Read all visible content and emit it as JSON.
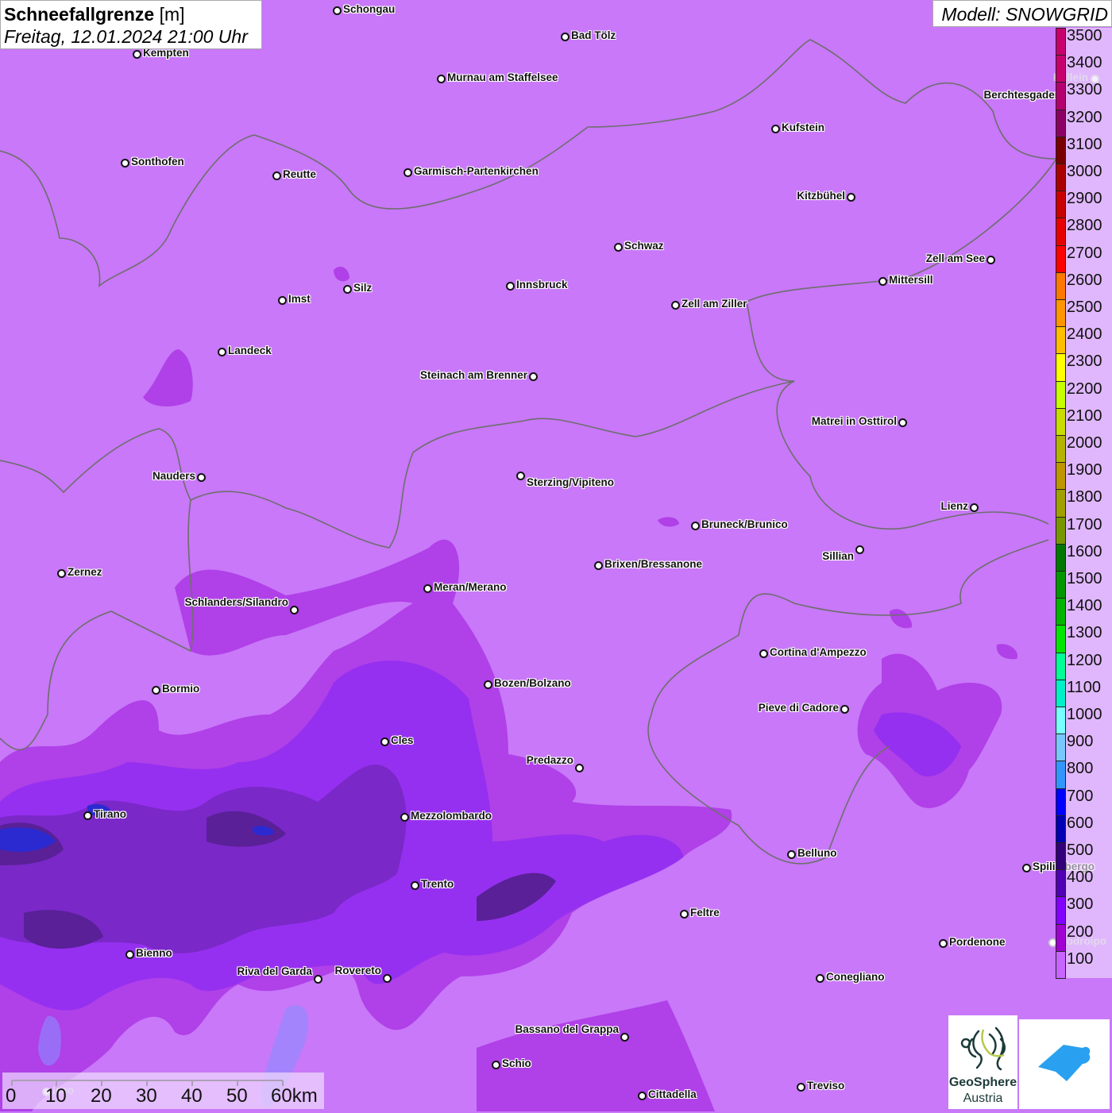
{
  "header": {
    "title": "Schneefallgrenze",
    "unit": "[m]",
    "datetime": "Freitag, 12.01.2024 21:00 Uhr"
  },
  "model": "Modell: SNOWGRID",
  "legend": {
    "labels": [
      "3500",
      "3400",
      "3300",
      "3200",
      "3100",
      "3000",
      "2900",
      "2800",
      "2700",
      "2600",
      "2500",
      "2400",
      "2300",
      "2200",
      "2100",
      "2000",
      "1900",
      "1800",
      "1700",
      "1600",
      "1500",
      "1400",
      "1300",
      "1200",
      "1100",
      "1000",
      "900",
      "800",
      "700",
      "600",
      "500",
      "400",
      "300",
      "200",
      "100"
    ],
    "colors": [
      "#c8006e",
      "#c8006e",
      "#b4006e",
      "#8c0064",
      "#780000",
      "#aa0000",
      "#c80000",
      "#e60000",
      "#ff0000",
      "#ff7800",
      "#ff9600",
      "#ffbe00",
      "#ffff00",
      "#c8ff00",
      "#c8dc00",
      "#b4b400",
      "#be9600",
      "#a0a000",
      "#789600",
      "#007800",
      "#009600",
      "#00b400",
      "#00e600",
      "#00ff96",
      "#00f0c8",
      "#78ffff",
      "#78c8ff",
      "#3296ff",
      "#0000ff",
      "#0000b4",
      "#320078",
      "#5000b4",
      "#8200ff",
      "#a000d2",
      "#c864ff"
    ]
  },
  "map_colors": {
    "background": "#c878f8",
    "border": "#6e6e6e",
    "lakes": "#8c8cff"
  },
  "cities": [
    "Schongau",
    "Bad Tölz",
    "Kempten",
    "Murnau am Staffelsee",
    "Kufstein",
    "Berchtesgaden",
    "Hallein",
    "Sonthofen",
    "Reutte",
    "Garmisch-Partenkirchen",
    "Kitzbühel",
    "Schwaz",
    "Zell am See",
    "Innsbruck",
    "Mittersill",
    "Silz",
    "Imst",
    "Zell am Ziller",
    "Landeck",
    "Steinach am Brenner",
    "Matrei in Osttirol",
    "Nauders",
    "Sterzing/Vipiteno",
    "Lienz",
    "Bruneck/Brunico",
    "Sillian",
    "Brixen/Bressanone",
    "Zernez",
    "Meran/Merano",
    "Schlanders/Silandro",
    "Cortina d'Ampezzo",
    "Bozen/Bolzano",
    "Bormio",
    "Pieve di Cadore",
    "Cles",
    "Predazzo",
    "Tirano",
    "Mezzolombardo",
    "Belluno",
    "Spilimbergo",
    "Trento",
    "Feltre",
    "Pordenone",
    "Codroipo",
    "Bienno",
    "Riva del Garda",
    "Rovereto",
    "Conegliano",
    "Bassano del Grappa",
    "Schio",
    "Treviso",
    "Cittadella",
    "Iseo"
  ],
  "scale": {
    "ticks": [
      "0",
      "10",
      "20",
      "30",
      "40",
      "50",
      "60km"
    ]
  },
  "logos": {
    "geosphere_line1": "GeoSphere",
    "geosphere_line2": "Austria"
  }
}
